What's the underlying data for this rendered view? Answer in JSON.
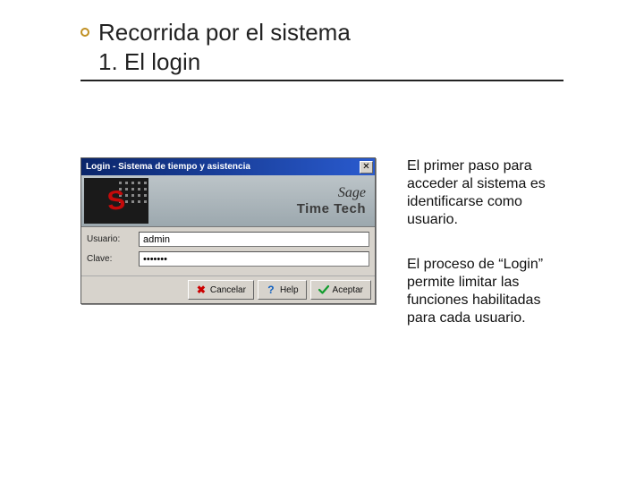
{
  "title": {
    "line1": "Recorrida por el sistema",
    "line2": "1. El login"
  },
  "paragraphs": {
    "p1": "El primer paso para acceder al sistema es identificarse como usuario.",
    "p2": "El proceso de “Login” permite limitar las funciones habilitadas para cada usuario."
  },
  "window": {
    "title": "Login - Sistema de tiempo y asistencia",
    "brand1": "Sage",
    "brand2": "Time Tech",
    "close_glyph": "✕",
    "fields": {
      "user_label": "Usuario:",
      "user_value": "admin",
      "pass_label": "Clave:",
      "pass_value": "•••••••"
    },
    "buttons": {
      "cancel": "Cancelar",
      "help": "Help",
      "accept": "Aceptar"
    }
  }
}
